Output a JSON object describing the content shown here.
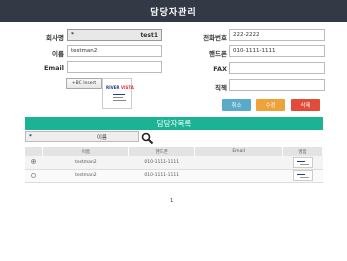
{
  "title": "담당자관리",
  "form": {
    "company_label": "회사명",
    "company_star": "*",
    "company_value": "test1",
    "name_label": "이름",
    "name_value": "testman2",
    "email_label": "Email",
    "email_value": "",
    "phone_label": "전화번호",
    "phone_value": "222-2222",
    "mobile_label": "핸드폰",
    "mobile_value": "010-1111-1111",
    "fax_label": "FAX",
    "fax_value": "",
    "position_label": "직책",
    "position_value": "",
    "bc_insert_label": "+BC Insert",
    "bc_logo_text": "RIVER",
    "bc_logo_accent": "VISTA"
  },
  "buttons": {
    "cancel": "취소",
    "edit": "수정",
    "delete": "삭제"
  },
  "list": {
    "header": "담당자목록",
    "search_star": "*",
    "search_field": "이름",
    "columns": [
      "",
      "이름",
      "핸드폰",
      "Email",
      "명함"
    ],
    "rows": [
      {
        "selected": true,
        "name": "testman2",
        "mobile": "010-1111-1111",
        "email": ""
      },
      {
        "selected": false,
        "name": "testman2",
        "mobile": "010-1111-1111",
        "email": ""
      }
    ]
  },
  "pager": {
    "current": "1"
  },
  "colors": {
    "titlebar": "#333a45",
    "list_header": "#1cb394",
    "cancel": "#5aabc9",
    "edit": "#f0a23a",
    "delete": "#e04b3a"
  }
}
